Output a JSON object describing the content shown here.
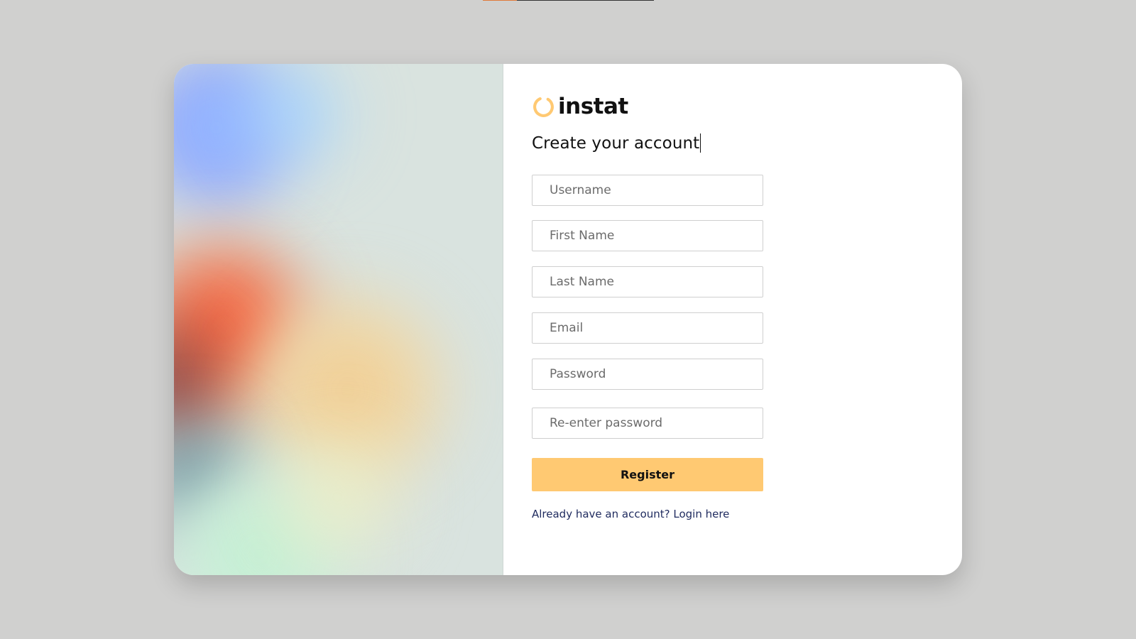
{
  "progress": {
    "fraction": 0.2
  },
  "brand": {
    "name": "instat",
    "logo_icon": "ring-logo-icon",
    "accent_color": "#ffc972"
  },
  "form": {
    "title": "Create your account",
    "fields": {
      "username": {
        "placeholder": "Username",
        "value": ""
      },
      "first_name": {
        "placeholder": "First Name",
        "value": ""
      },
      "last_name": {
        "placeholder": "Last Name",
        "value": ""
      },
      "email": {
        "placeholder": "Email",
        "value": ""
      },
      "password": {
        "placeholder": "Password",
        "value": ""
      },
      "confirm_password": {
        "placeholder": "Re-enter password",
        "value": ""
      }
    },
    "register_label": "Register",
    "login_link": "Already have an account? Login here"
  },
  "colors": {
    "page_background": "#d0d0cf",
    "link": "#1e2a5e"
  }
}
